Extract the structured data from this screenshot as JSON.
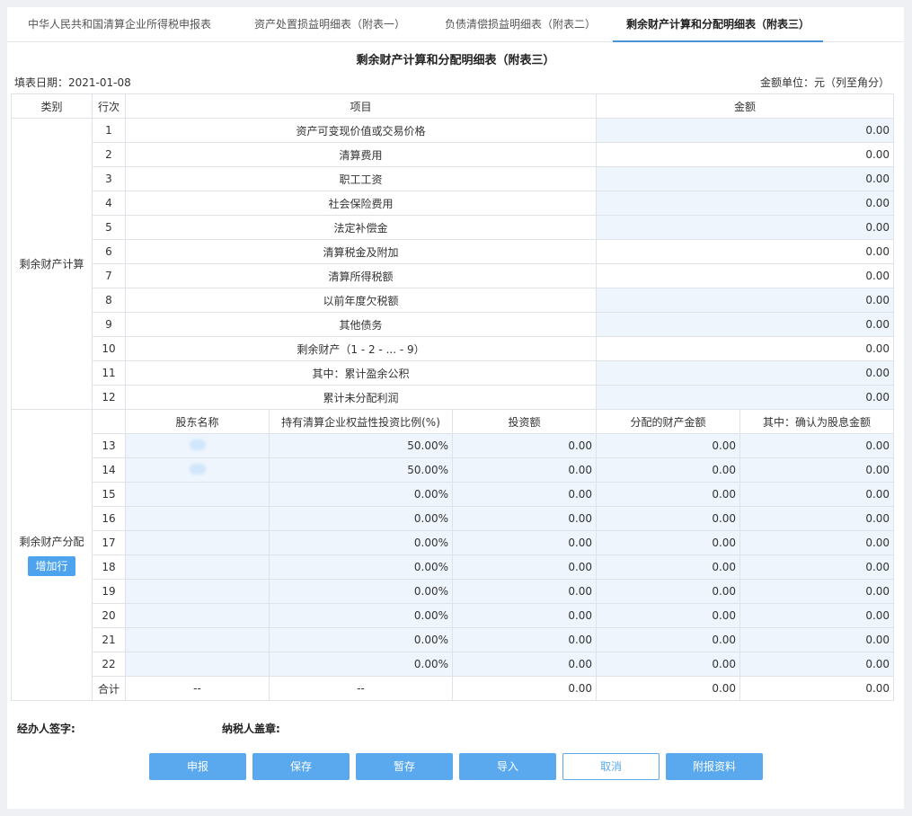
{
  "tabs": [
    "中华人民共和国清算企业所得税申报表",
    "资产处置损益明细表（附表一）",
    "负债清偿损益明细表（附表二）",
    "剩余财产计算和分配明细表（附表三）"
  ],
  "active_tab_index": 3,
  "form": {
    "title": "剩余财产计算和分配明细表（附表三）",
    "fill_date": "填表日期：2021-01-08",
    "unit": "金额单位：元（列至角分）"
  },
  "header": {
    "category": "类别",
    "row": "行次",
    "item": "项目",
    "amount": "金额"
  },
  "calc": {
    "category": "剩余财产计算",
    "rows": [
      {
        "no": "1",
        "item": "资产可变现价值或交易价格",
        "amount": "0.00",
        "editable": true
      },
      {
        "no": "2",
        "item": "清算费用",
        "amount": "0.00",
        "editable": false
      },
      {
        "no": "3",
        "item": "职工工资",
        "amount": "0.00",
        "editable": true
      },
      {
        "no": "4",
        "item": "社会保险费用",
        "amount": "0.00",
        "editable": true
      },
      {
        "no": "5",
        "item": "法定补偿金",
        "amount": "0.00",
        "editable": true
      },
      {
        "no": "6",
        "item": "清算税金及附加",
        "amount": "0.00",
        "editable": false
      },
      {
        "no": "7",
        "item": "清算所得税额",
        "amount": "0.00",
        "editable": false
      },
      {
        "no": "8",
        "item": "以前年度欠税额",
        "amount": "0.00",
        "editable": true
      },
      {
        "no": "9",
        "item": "其他债务",
        "amount": "0.00",
        "editable": true
      },
      {
        "no": "10",
        "item": "剩余财产（1 - 2 - ... - 9）",
        "amount": "0.00",
        "editable": false
      },
      {
        "no": "11",
        "item": "其中：累计盈余公积",
        "amount": "0.00",
        "editable": true
      },
      {
        "no": "12",
        "item": "累计未分配利润",
        "amount": "0.00",
        "editable": true
      }
    ]
  },
  "dist": {
    "category": "剩余财产分配",
    "add_row_label": "增加行",
    "columns": [
      "股东名称",
      "持有清算企业权益性投资比例(%)",
      "投资额",
      "分配的财产金额",
      "其中：确认为股息金额"
    ],
    "rows": [
      {
        "no": "13",
        "name": "",
        "ratio": "50.00%",
        "invest": "0.00",
        "distributed": "0.00",
        "dividend": "0.00"
      },
      {
        "no": "14",
        "name": "",
        "ratio": "50.00%",
        "invest": "0.00",
        "distributed": "0.00",
        "dividend": "0.00"
      },
      {
        "no": "15",
        "name": "",
        "ratio": "0.00%",
        "invest": "0.00",
        "distributed": "0.00",
        "dividend": "0.00"
      },
      {
        "no": "16",
        "name": "",
        "ratio": "0.00%",
        "invest": "0.00",
        "distributed": "0.00",
        "dividend": "0.00"
      },
      {
        "no": "17",
        "name": "",
        "ratio": "0.00%",
        "invest": "0.00",
        "distributed": "0.00",
        "dividend": "0.00"
      },
      {
        "no": "18",
        "name": "",
        "ratio": "0.00%",
        "invest": "0.00",
        "distributed": "0.00",
        "dividend": "0.00"
      },
      {
        "no": "19",
        "name": "",
        "ratio": "0.00%",
        "invest": "0.00",
        "distributed": "0.00",
        "dividend": "0.00"
      },
      {
        "no": "20",
        "name": "",
        "ratio": "0.00%",
        "invest": "0.00",
        "distributed": "0.00",
        "dividend": "0.00"
      },
      {
        "no": "21",
        "name": "",
        "ratio": "0.00%",
        "invest": "0.00",
        "distributed": "0.00",
        "dividend": "0.00"
      },
      {
        "no": "22",
        "name": "",
        "ratio": "0.00%",
        "invest": "0.00",
        "distributed": "0.00",
        "dividend": "0.00"
      }
    ],
    "total": {
      "label": "合计",
      "name": "--",
      "ratio": "--",
      "invest": "0.00",
      "distributed": "0.00",
      "dividend": "0.00"
    }
  },
  "signatures": {
    "handler": "经办人签字:",
    "taxpayer": "纳税人盖章:"
  },
  "buttons": [
    "申报",
    "保存",
    "暂存",
    "导入",
    "取消",
    "附报资料"
  ],
  "colors": {
    "accent": "#4a90d9",
    "editable_bg": "#eef5fd",
    "editable_text": "#3a8fd6",
    "button": "#5aa9ee"
  }
}
